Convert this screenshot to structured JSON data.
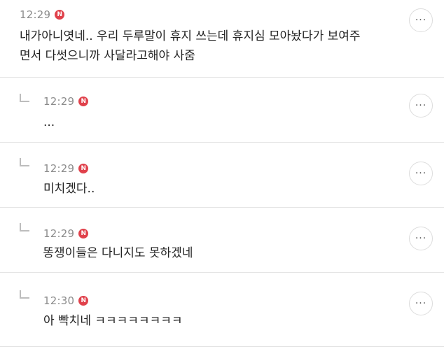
{
  "icons": {
    "badge": "n-badge-icon",
    "reply": "reply-arrow-icon",
    "more": "more-options-icon"
  },
  "colors": {
    "badge": "#e0414b",
    "time": "#8c8c8c"
  },
  "comments": [
    {
      "time": "12:29",
      "badge": "N",
      "more": "···",
      "text": "내가아니엿네.. 우리 두루말이 휴지 쓰는데 휴지심 모아놨다가 보여주\n면서 다썻으니까 사달라고해야 사줌"
    },
    {
      "time": "12:29",
      "badge": "N",
      "more": "···",
      "text": "..."
    },
    {
      "time": "12:29",
      "badge": "N",
      "more": "···",
      "text": "미치겠다.."
    },
    {
      "time": "12:29",
      "badge": "N",
      "more": "···",
      "text": " 똥쟁이들은 다니지도 못하겠네"
    },
    {
      "time": "12:30",
      "badge": "N",
      "more": "···",
      "text": "아 빡치네 ㅋㅋㅋㅋㅋㅋㅋㅋ"
    }
  ]
}
